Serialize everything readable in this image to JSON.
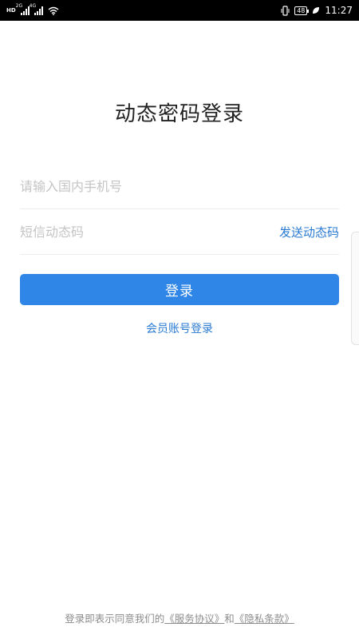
{
  "status_bar": {
    "hd_label": "HD",
    "signal1_label": "2G",
    "signal2_label": "4G",
    "battery_level": "48",
    "time": "11:27"
  },
  "page": {
    "title": "动态密码登录"
  },
  "form": {
    "phone_placeholder": "请输入国内手机号",
    "code_placeholder": "短信动态码",
    "send_code_label": "发送动态码",
    "login_label": "登录",
    "member_login_label": "会员账号登录"
  },
  "agreement": {
    "prefix": "登录即表示同意我们的",
    "service_link": "《服务协议》",
    "conjunction": "和",
    "privacy_link": "《隐私条款》"
  },
  "colors": {
    "accent": "#2f86e6",
    "link": "#2a7ad2",
    "status_bar_bg": "#000000"
  }
}
